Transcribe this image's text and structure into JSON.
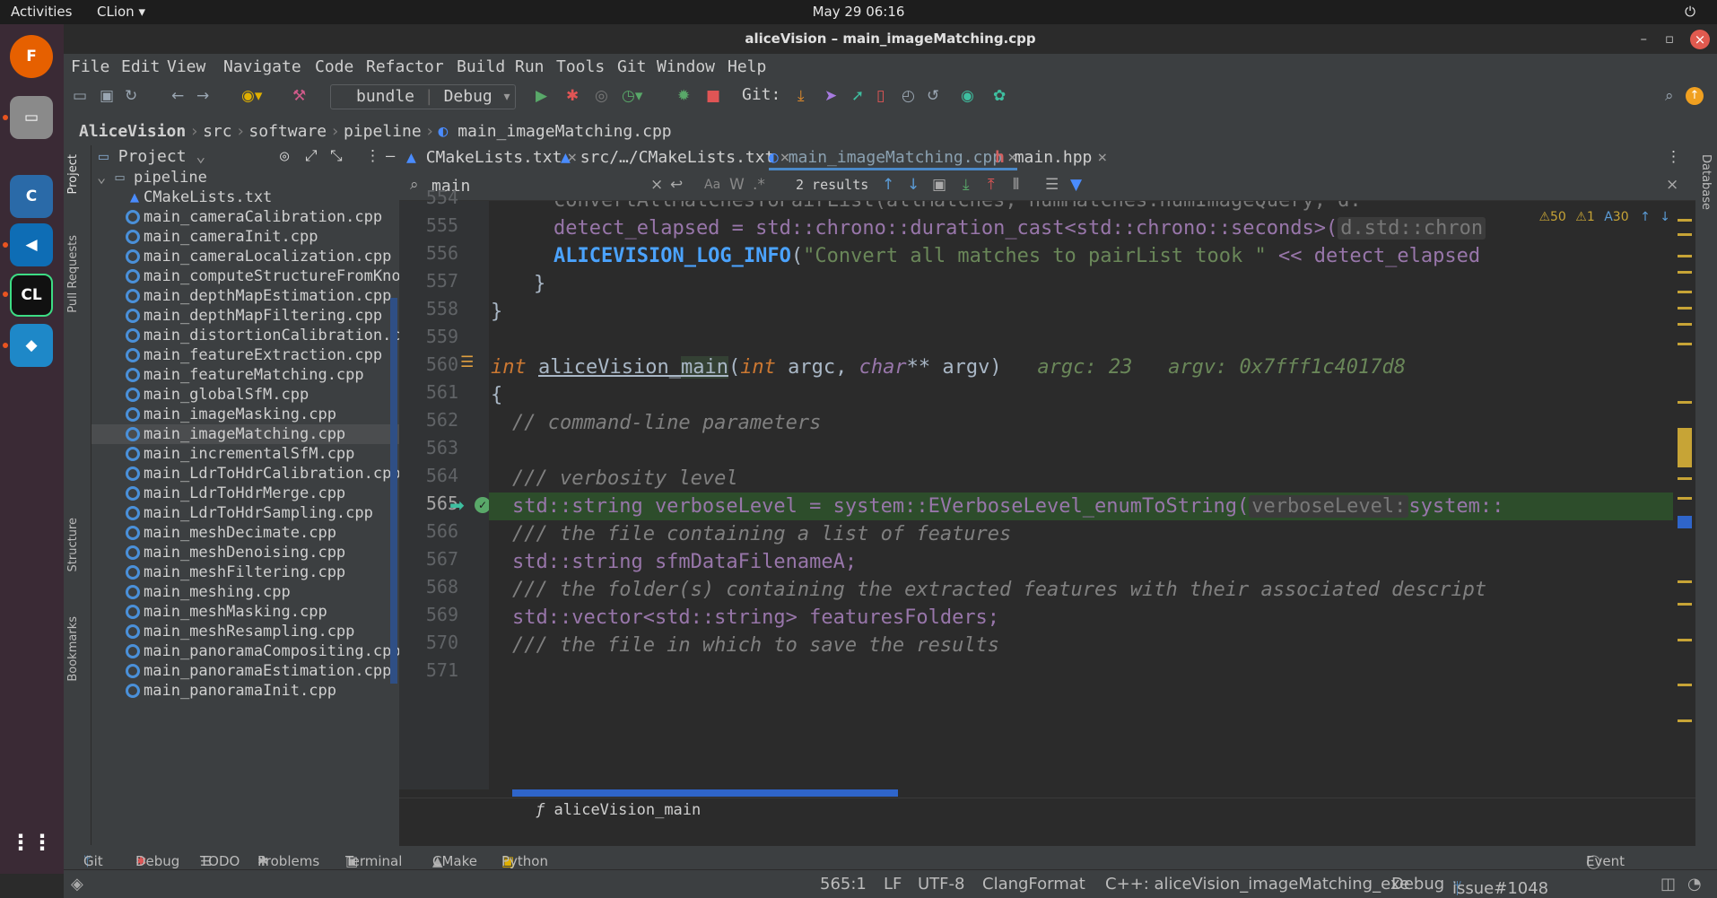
{
  "topbar": {
    "activities": "Activities",
    "app": "CLion ▾",
    "clock": "May 29  06:16"
  },
  "window": {
    "title": "aliceVision – main_imageMatching.cpp"
  },
  "menu": [
    "File",
    "Edit",
    "View",
    "Navigate",
    "Code",
    "Refactor",
    "Build",
    "Run",
    "Tools",
    "Git",
    "Window",
    "Help"
  ],
  "toolbar": {
    "config_name": "bundle",
    "config_mode": "Debug",
    "git_label": "Git:"
  },
  "breadcrumb": [
    "AliceVision",
    "src",
    "software",
    "pipeline",
    "main_imageMatching.cpp"
  ],
  "project": {
    "header": "Project",
    "folder": "pipeline",
    "files": [
      "CMakeLists.txt",
      "main_cameraCalibration.cpp",
      "main_cameraInit.cpp",
      "main_cameraLocalization.cpp",
      "main_computeStructureFromKnownPoses.cpp",
      "main_depthMapEstimation.cpp",
      "main_depthMapFiltering.cpp",
      "main_distortionCalibration.cpp",
      "main_featureExtraction.cpp",
      "main_featureMatching.cpp",
      "main_globalSfM.cpp",
      "main_imageMasking.cpp",
      "main_imageMatching.cpp",
      "main_incrementalSfM.cpp",
      "main_LdrToHdrCalibration.cpp",
      "main_LdrToHdrMerge.cpp",
      "main_LdrToHdrSampling.cpp",
      "main_meshDecimate.cpp",
      "main_meshDenoising.cpp",
      "main_meshFiltering.cpp",
      "main_meshing.cpp",
      "main_meshMasking.cpp",
      "main_meshResampling.cpp",
      "main_panoramaCompositing.cpp",
      "main_panoramaEstimation.cpp",
      "main_panoramaInit.cpp"
    ]
  },
  "tabs": [
    "CMakeLists.txt",
    "src/…/CMakeLists.txt",
    "main_imageMatching.cpp",
    "main.hpp"
  ],
  "search": {
    "query": "main",
    "results": "2 results"
  },
  "inspections": {
    "warnings": "50",
    "weak": "1",
    "typos": "30"
  },
  "line_numbers": [
    "554",
    "555",
    "556",
    "557",
    "558",
    "559",
    "560",
    "561",
    "562",
    "563",
    "564",
    "565",
    "566",
    "567",
    "568",
    "569",
    "570",
    "571"
  ],
  "code": {
    "l555_a": "detect_elapsed = std::chrono::duration_cast<std::chrono::seconds>(",
    "l555_b": "d.std::chron",
    "l556_a": "ALICEVISION_LOG_INFO",
    "l556_b": "(",
    "l556_c": "\"Convert all matches to pairList took \"",
    "l556_d": " << detect_elapsed",
    "l557": "}",
    "l558": "}",
    "l560_a": "int",
    "l560_b": "aliceVision_",
    "l560_c": "main",
    "l560_d": "(",
    "l560_e": "int",
    "l560_f": " argc, ",
    "l560_g": "char",
    "l560_h": "** argv)",
    "l560_hint1": "argc: 23",
    "l560_hint2": "argv: 0x7fff1c4017d8",
    "l561": "{",
    "l562": "// command-line parameters",
    "l564": "/// verbosity level",
    "l565_a": "std::string verboseLevel = system::EVerboseLevel_enumToString(",
    "l565_hint": "verboseLevel:",
    "l565_b": "system::",
    "l566": "/// the file containing a list of features",
    "l567": "std::string sfmDataFilenameA;",
    "l568": "/// the folder(s) containing the extracted features with their associated descript",
    "l569": "std::vector<std::string> featuresFolders;",
    "l570": "/// the file in which to save the results"
  },
  "crumb": "aliceVision_main",
  "toolwindows": [
    "Git",
    "Debug",
    "TODO",
    "Problems",
    "Terminal",
    "CMake",
    "Python Packages"
  ],
  "event_log": "Event Log",
  "status": {
    "pos": "565:1",
    "lf": "LF",
    "enc": "UTF-8",
    "fmt": "ClangFormat",
    "ctx": "C++: aliceVision_imageMatching_exe",
    "mode": "Debug",
    "branch": "issue#1048"
  },
  "side_tabs": {
    "project": "Project",
    "pull": "Pull Requests",
    "structure": "Structure",
    "bookmarks": "Bookmarks",
    "database": "Database"
  },
  "colors": {
    "accent": "#4a88c7",
    "exec_line": "#2d4d2b",
    "keyword": "#cc7832",
    "comment": "#808080",
    "string": "#6a8759"
  }
}
